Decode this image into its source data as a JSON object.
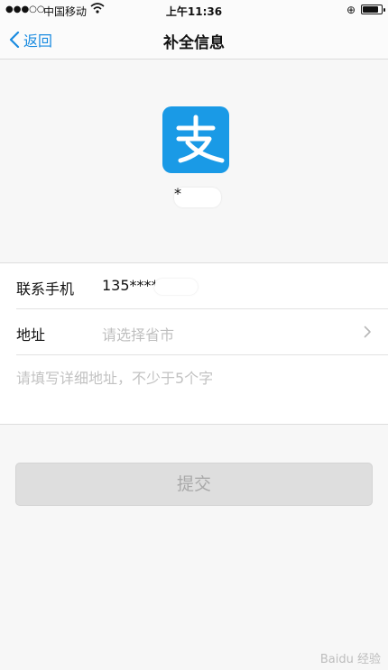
{
  "status_bar": {
    "signal": "●●●○○",
    "carrier": "中国移动",
    "time": "上午11:36",
    "battery_level": 0.85
  },
  "nav": {
    "back_label": "返回",
    "title": "补全信息"
  },
  "profile": {
    "logo_char": "支",
    "name": "*"
  },
  "form": {
    "phone_label": "联系手机",
    "phone_value": "135****",
    "address_label": "地址",
    "address_placeholder": "请选择省市",
    "detail_placeholder": "请填写详细地址，不少于5个字"
  },
  "submit_label": "提交",
  "watermark": "Baidu 经验",
  "colors": {
    "accent": "#1a8be0",
    "logo": "#1a9ae6",
    "button_bg": "#dedede",
    "button_text": "#a9a9a9"
  }
}
